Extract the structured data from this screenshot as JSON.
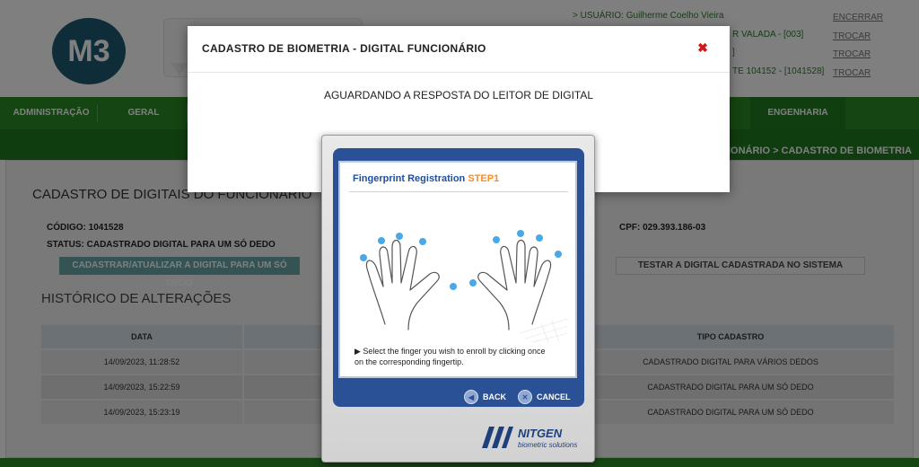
{
  "header": {
    "logo_text": "M3",
    "user_label": "> USUÁRIO:",
    "user_name": "Guilherme Coelho Vieira",
    "row2_text": "R VALADA - [003]",
    "row3_text": "]",
    "row4_text": "TE 104152 - [1041528]",
    "links": [
      "ENCERRAR",
      "TROCAR",
      "TROCAR",
      "TROCAR"
    ]
  },
  "menu": {
    "items": [
      "ADMINISTRAÇÃO",
      "GERAL",
      "ENGENHARIA"
    ]
  },
  "breadcrumb": "NCIONÁRIO > CADASTRO DE BIOMETRIA",
  "page": {
    "title": "CADASTRO DE DIGITAIS DO FUNCIONÁRIO",
    "codigo": "CÓDIGO: 1041528",
    "status": "STATUS: CADASTRADO DIGITAL PARA UM SÓ DEDO",
    "cpf": "CPF: 029.393.186-03",
    "update_button": "CADASTRAR/ATUALIZAR A DIGITAL PARA UM SÓ DEDO",
    "test_button": "TESTAR A DIGITAL CADASTRADA NO SISTEMA",
    "history_title": "HISTÓRICO DE ALTERAÇÕES"
  },
  "history": {
    "headers": [
      "DATA",
      "",
      "TIPO CADASTRO"
    ],
    "rows": [
      {
        "date": "14/09/2023, 11:28:52",
        "type": "CADASTRADO DIGITAL PARA VÁRIOS DEDOS"
      },
      {
        "date": "14/09/2023, 15:22:59",
        "type": "CADASTRADO DIGITAL PARA UM SÓ DEDO"
      },
      {
        "date": "14/09/2023, 15:23:19",
        "type": "CADASTRADO DIGITAL PARA UM SÓ DEDO"
      }
    ]
  },
  "modal": {
    "title": "CADASTRO DE BIOMETRIA - DIGITAL FUNCIONÁRIO",
    "close_icon": "close-icon",
    "message": "AGUARDANDO A RESPOSTA DO LEITOR DE DIGITAL"
  },
  "nitgen": {
    "title": "Fingerprint Registration",
    "step": "STEP1",
    "instruction_line1": "Select the finger you wish to enroll by clicking once",
    "instruction_line2": "on the corresponding fingertip.",
    "back_label": "BACK",
    "cancel_label": "CANCEL",
    "brand": "NITGEN",
    "brand_sub": "biometric solutions"
  },
  "colors": {
    "menu_green": "#2a8a25",
    "fingertip_blue": "#4aa8e8",
    "nitgen_blue": "#2a5095",
    "close_red": "#d01818"
  }
}
